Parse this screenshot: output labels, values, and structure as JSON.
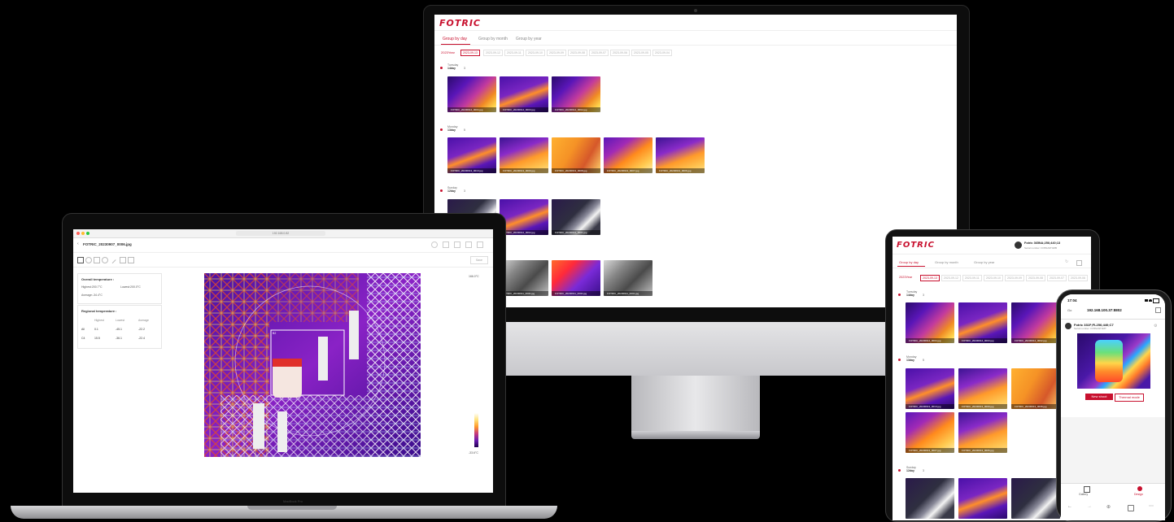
{
  "brand": {
    "name": "FOTRIC",
    "color": "#c8102e"
  },
  "monitor": {
    "tabs": [
      "Group by day",
      "Group by month",
      "Group by year"
    ],
    "year_chip": "2023Year",
    "date_chips": [
      "2023-09-13",
      "2023-09-12",
      "2023-09-11",
      "2023-09-10",
      "2023-09-09",
      "2023-09-08",
      "2023-09-07",
      "2023-09-06",
      "2023-09-05",
      "2023-09-04"
    ],
    "groups": [
      {
        "label": "Tuesday",
        "day": "14day",
        "count": "3"
      },
      {
        "label": "Monday",
        "day": "13day",
        "count": "5"
      },
      {
        "label": "Sunday",
        "day": "12day",
        "count": "3"
      },
      {
        "label": "Saturday",
        "day": "11day",
        "count": "4"
      }
    ]
  },
  "laptop": {
    "url": "192.168.0.82",
    "file_name": "FOTRIC_20230907_0006.jpg",
    "save_label": "Save",
    "overall": {
      "title": "Overall temperature :",
      "highest": "Highest:200.7°C",
      "lowest": "Lowest:200.0°C",
      "average": "Average:-34.4°C"
    },
    "regional": {
      "title": "Regional temperature :",
      "headers": [
        "",
        "Highest",
        "Lowest",
        "Average"
      ],
      "rows": [
        [
          "All",
          "0.1",
          "-45.1",
          "-22.2"
        ],
        [
          "C4",
          "15.5",
          "-36.1",
          "-22.4"
        ]
      ]
    },
    "scale_max": "166.0°C",
    "scale_min": "-33.6°C",
    "box_label": "B2",
    "brand_label": "MacBook Pro"
  },
  "tablet": {
    "user": "Fotric 365NA;256;440;13",
    "serial": "Serial number: FO5NA9T4MB",
    "tabs": [
      "Group by day",
      "Group by month",
      "Group by year"
    ],
    "year_chip": "2023Year",
    "date_chips": [
      "2023-09-13",
      "2023-09-12",
      "2023-09-11",
      "2023-09-10",
      "2023-09-09",
      "2023-09-08",
      "2023-09-07",
      "2023-09-06"
    ],
    "groups": [
      {
        "label": "Tuesday",
        "day": "14day",
        "count": "3"
      },
      {
        "label": "Monday",
        "day": "13day",
        "count": "5"
      },
      {
        "label": "Sunday",
        "day": "12day",
        "count": "3"
      }
    ]
  },
  "phone": {
    "time": "17:04",
    "carrier": "Go",
    "url": "192.168.100.37:8802",
    "device": "Fotric 331F;FL256;440;C7",
    "serial": "Serial number: FO5NA9T4MT",
    "btn_new": "New shoot",
    "btn_thermal": "Thermal mode",
    "nav": [
      "Gallery",
      "Design"
    ]
  }
}
